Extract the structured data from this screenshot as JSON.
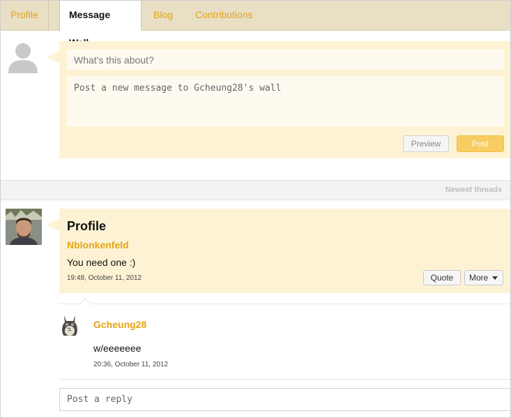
{
  "tabs": [
    {
      "label": "Profile"
    },
    {
      "label": "Message Wall"
    },
    {
      "label": "Blog"
    },
    {
      "label": "Contributions"
    }
  ],
  "active_tab": "Message Wall",
  "compose": {
    "title_placeholder": "What's this about?",
    "body_placeholder": "Post a new message to Gcheung28's wall",
    "preview_label": "Preview",
    "post_label": "Post"
  },
  "sort": {
    "label": "Newest threads"
  },
  "thread": {
    "title": "Profile",
    "author": "Nblonkenfeld",
    "text": "You need one :)",
    "timestamp": "19:48, October 11, 2012",
    "quote_label": "Quote",
    "more_label": "More"
  },
  "reply": {
    "author": "Gcheung28",
    "text": "w/eeeeeee",
    "timestamp": "20:36, October 11, 2012"
  },
  "reply_input": {
    "placeholder": "Post a reply"
  },
  "colors": {
    "accent": "#e6a413",
    "panel": "#fdf3d4",
    "tab_bar": "#e8dfc4",
    "post_button": "#f7cc63"
  }
}
